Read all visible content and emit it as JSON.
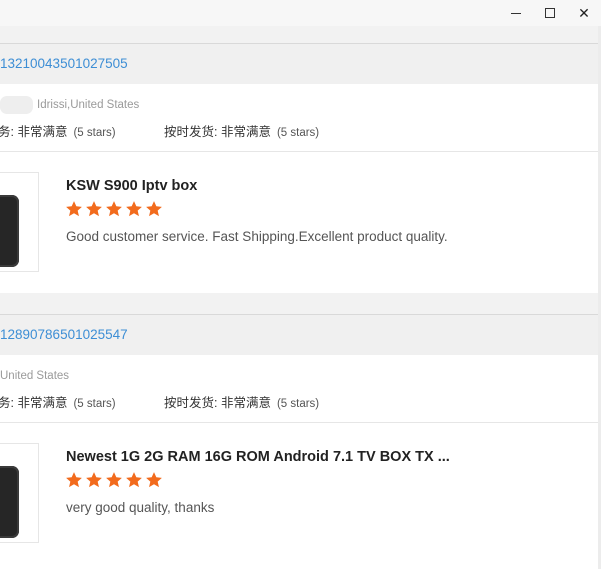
{
  "window": {
    "controls": {
      "minimize_icon": "minimize-icon",
      "maximize_icon": "maximize-icon",
      "close_icon": "close-icon",
      "close_glyph": "✕"
    }
  },
  "colors": {
    "link": "#3d8ed5",
    "star": "#f26b1d",
    "order_bar": "#f0f0f0"
  },
  "reviews": [
    {
      "order_id": "13210043501027505",
      "buyer_location": "Idrissi,United States",
      "service_label": "务: 非常满意",
      "service_stars": "(5 stars)",
      "shipping_label": "按时发货: 非常满意",
      "shipping_stars": "(5 stars)",
      "product_title": "KSW S900 Iptv box",
      "rating": 5,
      "review_text": "Good customer service. Fast Shipping.Excellent product quality."
    },
    {
      "order_id": "12890786501025547",
      "buyer_location": "United States",
      "service_label": "务: 非常满意",
      "service_stars": "(5 stars)",
      "shipping_label": "按时发货: 非常满意",
      "shipping_stars": "(5 stars)",
      "product_title": "Newest 1G 2G RAM 16G ROM Android 7.1 TV BOX TX ...",
      "rating": 5,
      "review_text": "very good quality, thanks"
    }
  ]
}
